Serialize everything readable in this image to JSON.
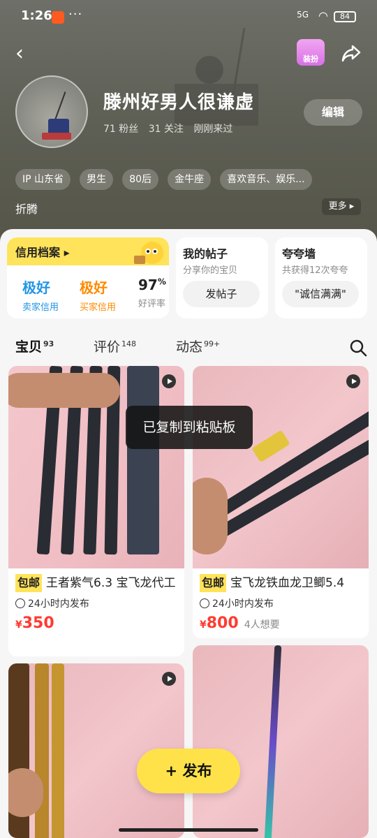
{
  "status_bar": {
    "time": "1:26",
    "dots": "···",
    "signal": "5G",
    "battery": "84"
  },
  "header": {
    "shirt_label": "装扮",
    "nickname": "滕州好男人很谦虚",
    "fans": "71 粉丝",
    "follows": "31 关注",
    "last_seen": "刚刚来过",
    "edit_label": "编辑",
    "tags": [
      "IP 山东省",
      "男生",
      "80后",
      "金牛座",
      "喜欢音乐、娱乐..."
    ],
    "fold_label": "折腾",
    "more_label": "更多 ▸"
  },
  "credit": {
    "title": "信用档案 ▸",
    "seller_value": "极好",
    "seller_label": "卖家信用",
    "buyer_value": "极好",
    "buyer_label": "买家信用",
    "rate_value": "97",
    "rate_unit": "%",
    "rate_label": "好评率"
  },
  "posts": {
    "title": "我的帖子",
    "subtitle": "分享你的宝贝",
    "button": "发帖子"
  },
  "wall": {
    "title": "夸夸墙",
    "subtitle": "共获得12次夸夸",
    "button": "\"诚信满满\""
  },
  "tabs": [
    {
      "label": "宝贝",
      "count": "93"
    },
    {
      "label": "评价",
      "count": "148"
    },
    {
      "label": "动态",
      "count": "99+"
    }
  ],
  "items": [
    {
      "badge": "包邮",
      "title": "王者紫气6.3 宝飞龙代工",
      "time": "24小时内发布",
      "price": "350",
      "want": ""
    },
    {
      "badge": "包邮",
      "title": "宝飞龙铁血龙卫鲫5.4",
      "time": "24小时内发布",
      "price": "800",
      "want": "4人想要"
    }
  ],
  "toast": "已复制到粘贴板",
  "publish": "+ 发布",
  "colors": {
    "accent": "#ffe35a",
    "price": "#ff3b30",
    "seller": "#2196e6",
    "buyer": "#ff8a00"
  }
}
